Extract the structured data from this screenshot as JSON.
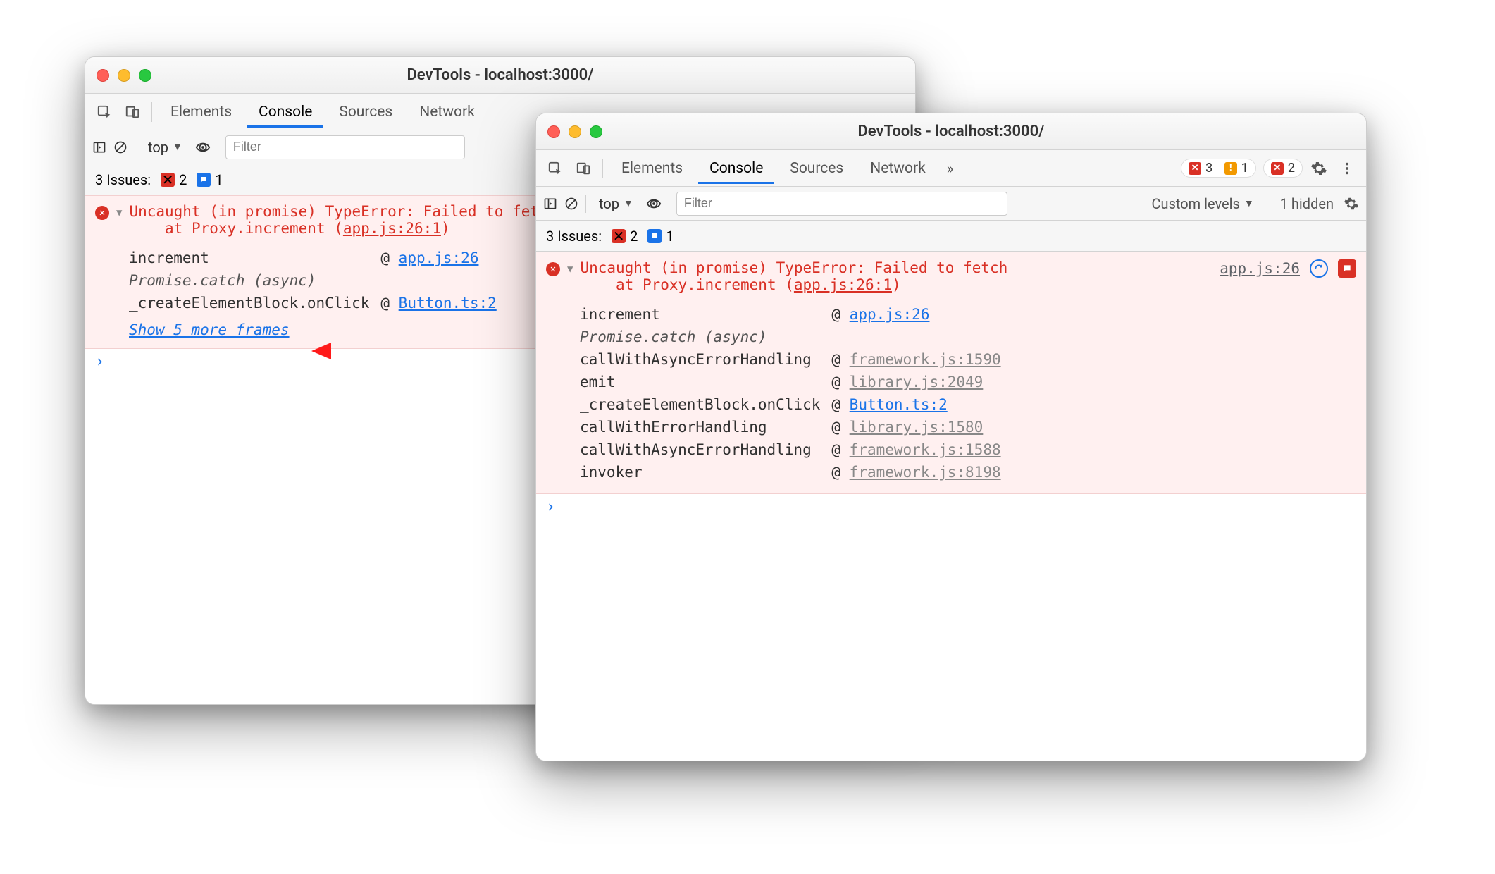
{
  "shared": {
    "window_title": "DevTools - localhost:3000/",
    "tabs": {
      "elements": "Elements",
      "console": "Console",
      "sources": "Sources",
      "network": "Network"
    },
    "filter_placeholder": "Filter",
    "context_label": "top",
    "issues_label": "3 Issues:",
    "issues_err": "2",
    "issues_info": "1",
    "error_line1": "Uncaught (in promise) TypeError: Failed to fetch",
    "error_line2_prefix": "at Proxy.increment (",
    "error_line2_link": "app.js:26:1",
    "error_line2_suffix": ")",
    "promise_async": "Promise.catch (async)",
    "at": "@",
    "prompt": "›"
  },
  "window_a": {
    "show_more": "Show 5 more frames",
    "stack": [
      {
        "fn": "increment",
        "loc": "app.js:26",
        "muted": false
      },
      {
        "fn": "_PROMISE_",
        "loc": "",
        "muted": false
      },
      {
        "fn": "_createElementBlock.onClick",
        "loc": "Button.ts:2",
        "muted": false
      }
    ]
  },
  "window_b": {
    "badges": {
      "err": "3",
      "warn": "1",
      "info2": "2"
    },
    "levels_label": "Custom levels",
    "hidden_label": "1 hidden",
    "origin_link": "app.js:26",
    "stack": [
      {
        "fn": "increment",
        "loc": "app.js:26",
        "muted": false
      },
      {
        "fn": "_PROMISE_",
        "loc": "",
        "muted": false
      },
      {
        "fn": "callWithAsyncErrorHandling",
        "loc": "framework.js:1590",
        "muted": true
      },
      {
        "fn": "emit",
        "loc": "library.js:2049",
        "muted": true
      },
      {
        "fn": "_createElementBlock.onClick",
        "loc": "Button.ts:2",
        "muted": false
      },
      {
        "fn": "callWithErrorHandling",
        "loc": "library.js:1580",
        "muted": true
      },
      {
        "fn": "callWithAsyncErrorHandling",
        "loc": "framework.js:1588",
        "muted": true
      },
      {
        "fn": "invoker",
        "loc": "framework.js:8198",
        "muted": true
      }
    ]
  }
}
